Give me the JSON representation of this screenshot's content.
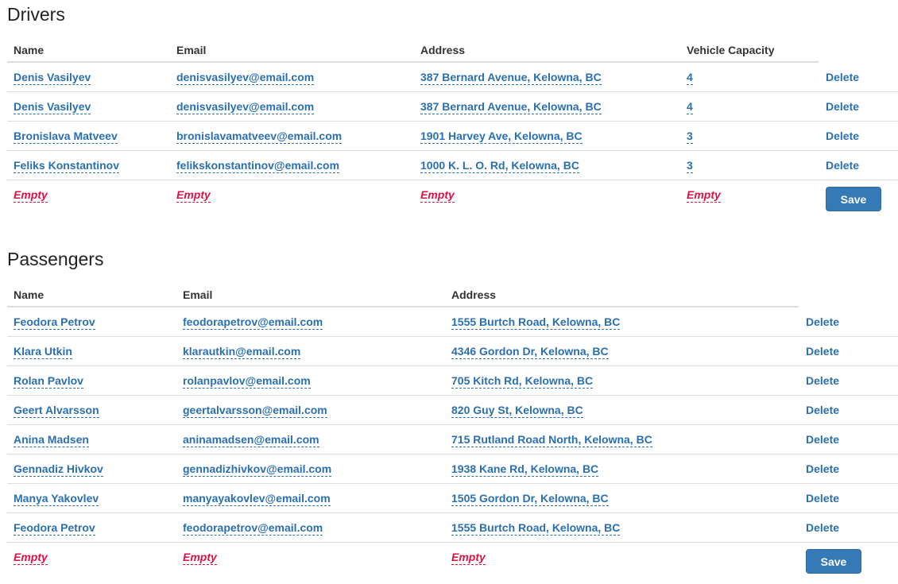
{
  "drivers": {
    "title": "Drivers",
    "headers": [
      "Name",
      "Email",
      "Address",
      "Vehicle Capacity"
    ],
    "rows": [
      {
        "name": "Denis Vasilyev",
        "email": "denisvasilyev@email.com",
        "address": "387 Bernard Avenue, Kelowna, BC",
        "capacity": "4",
        "delete": "Delete"
      },
      {
        "name": "Denis Vasilyev",
        "email": "denisvasilyev@email.com",
        "address": "387 Bernard Avenue, Kelowna, BC",
        "capacity": "4",
        "delete": "Delete"
      },
      {
        "name": "Bronislava Matveev",
        "email": "bronislavamatveev@email.com",
        "address": "1901 Harvey Ave, Kelowna, BC",
        "capacity": "3",
        "delete": "Delete"
      },
      {
        "name": "Feliks Konstantinov",
        "email": "felikskonstantinov@email.com",
        "address": "1000 K. L. O. Rd, Kelowna, BC",
        "capacity": "3",
        "delete": "Delete"
      }
    ],
    "new_row": {
      "name": "Empty",
      "email": "Empty",
      "address": "Empty",
      "capacity": "Empty",
      "save": "Save"
    }
  },
  "passengers": {
    "title": "Passengers",
    "headers": [
      "Name",
      "Email",
      "Address"
    ],
    "rows": [
      {
        "name": "Feodora Petrov",
        "email": "feodorapetrov@email.com",
        "address": "1555 Burtch Road, Kelowna, BC",
        "delete": "Delete"
      },
      {
        "name": "Klara Utkin",
        "email": "klarautkin@email.com",
        "address": "4346 Gordon Dr, Kelowna, BC",
        "delete": "Delete"
      },
      {
        "name": "Rolan Pavlov",
        "email": "rolanpavlov@email.com",
        "address": "705 Kitch Rd, Kelowna, BC",
        "delete": "Delete"
      },
      {
        "name": "Geert Alvarsson",
        "email": "geertalvarsson@email.com",
        "address": "820 Guy St, Kelowna, BC",
        "delete": "Delete"
      },
      {
        "name": "Anina Madsen",
        "email": "aninamadsen@email.com",
        "address": "715 Rutland Road North, Kelowna, BC",
        "delete": "Delete"
      },
      {
        "name": "Gennadiz Hivkov",
        "email": "gennadizhivkov@email.com",
        "address": "1938 Kane Rd, Kelowna, BC",
        "delete": "Delete"
      },
      {
        "name": "Manya Yakovlev",
        "email": "manyayakovlev@email.com",
        "address": "1505 Gordon Dr, Kelowna, BC",
        "delete": "Delete"
      },
      {
        "name": "Feodora Petrov",
        "email": "feodorapetrov@email.com",
        "address": "1555 Burtch Road, Kelowna, BC",
        "delete": "Delete"
      }
    ],
    "new_row": {
      "name": "Empty",
      "email": "Empty",
      "address": "Empty",
      "save": "Save"
    }
  },
  "colors": {
    "link": "#2a6fb0",
    "empty": "#dd1144",
    "button": "#337ab7",
    "divider": "#dddddd"
  }
}
